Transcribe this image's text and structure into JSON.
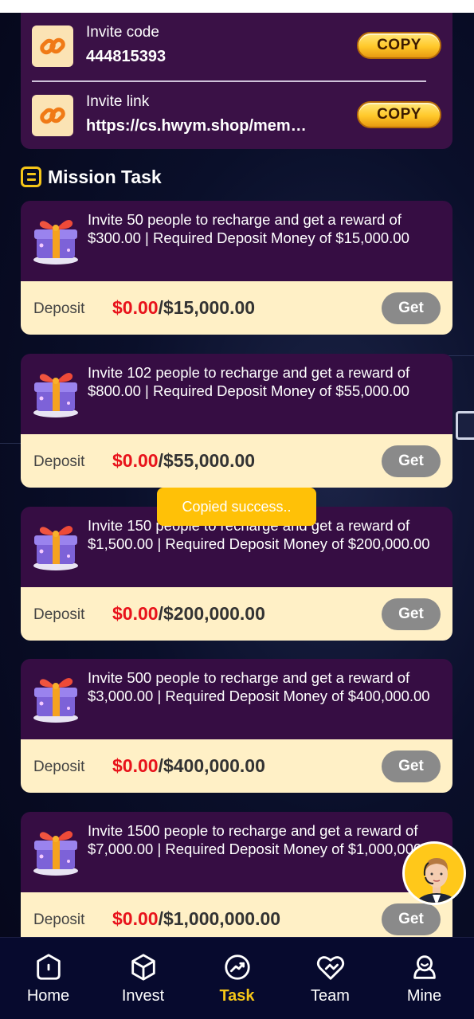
{
  "invite": {
    "code_label": "Invite code",
    "code_value": "444815393",
    "link_label": "Invite link",
    "link_value": "https://cs.hwym.shop/mem…",
    "copy_label": "COPY"
  },
  "section": {
    "title": "Mission Task"
  },
  "tasks": [
    {
      "desc": "Invite 50 people to recharge and get a reward of $300.00 | Required Deposit Money of $15,000.00",
      "deposit_label": "Deposit",
      "current": "$0.00",
      "target": "/$15,000.00",
      "button": "Get"
    },
    {
      "desc": "Invite 102 people to recharge and get a reward of $800.00 | Required Deposit Money of $55,000.00",
      "deposit_label": "Deposit",
      "current": "$0.00",
      "target": "/$55,000.00",
      "button": "Get"
    },
    {
      "desc": "Invite 150 people to recharge and get a reward of $1,500.00 | Required Deposit Money of $200,000.00",
      "deposit_label": "Deposit",
      "current": "$0.00",
      "target": "/$200,000.00",
      "button": "Get"
    },
    {
      "desc": "Invite 500 people to recharge and get a reward of $3,000.00 | Required Deposit Money of $400,000.00",
      "deposit_label": "Deposit",
      "current": "$0.00",
      "target": "/$400,000.00",
      "button": "Get"
    },
    {
      "desc": "Invite 1500 people to recharge and get a reward of $7,000.00 | Required Deposit Money of $1,000,000.00",
      "deposit_label": "Deposit",
      "current": "$0.00",
      "target": "/$1,000,000.00",
      "button": "Get"
    }
  ],
  "toast": {
    "text": "Copied success.."
  },
  "nav": {
    "items": [
      {
        "label": "Home",
        "icon": "home-icon"
      },
      {
        "label": "Invest",
        "icon": "cube-icon"
      },
      {
        "label": "Task",
        "icon": "trend-icon"
      },
      {
        "label": "Team",
        "icon": "team-heart-icon"
      },
      {
        "label": "Mine",
        "icon": "user-icon"
      }
    ],
    "active": "Task"
  },
  "colors": {
    "panel": "#3a1146",
    "card_top": "#360d43",
    "card_bottom": "#fff0c6",
    "accent": "#f5c518",
    "progress_current": "#e8131b",
    "button_disabled": "#8a8a8a",
    "toast": "#ffc107"
  }
}
